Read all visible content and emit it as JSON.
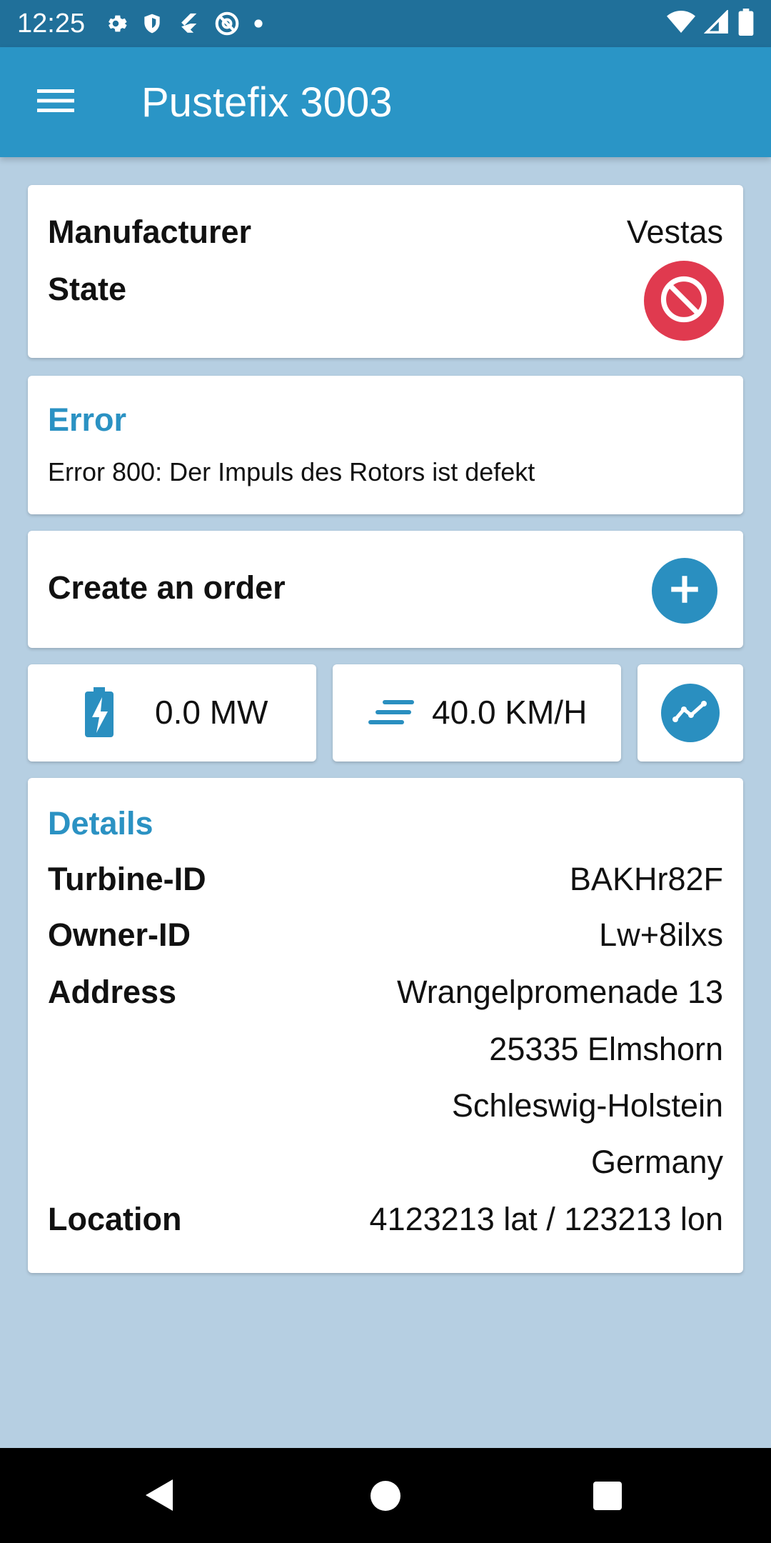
{
  "status_bar": {
    "time": "12:25",
    "icons": [
      "gear-icon",
      "shield-icon",
      "flutter-icon",
      "at-sign-icon",
      "dot-icon"
    ],
    "right_icons": [
      "wifi-icon",
      "signal-icon",
      "battery-icon"
    ]
  },
  "app_bar": {
    "title": "Pustefix 3003",
    "menu_icon": "hamburger-menu-icon"
  },
  "summary": {
    "manufacturer_label": "Manufacturer",
    "manufacturer_value": "Vestas",
    "state_label": "State",
    "state_icon": "block-icon",
    "state_color": "#e03a4f"
  },
  "error": {
    "title": "Error",
    "message": "Error 800: Der Impuls des Rotors ist defekt"
  },
  "order": {
    "label": "Create an order",
    "icon": "plus-icon"
  },
  "stats": {
    "power": {
      "icon": "battery-charging-icon",
      "value": "0.0 MW"
    },
    "wind": {
      "icon": "wind-lines-icon",
      "value": "40.0 KM/H"
    },
    "chart_icon": "trending-line-icon"
  },
  "details": {
    "title": "Details",
    "turbine_id_label": "Turbine-ID",
    "turbine_id_value": "BAKHr82F",
    "owner_id_label": "Owner-ID",
    "owner_id_value": "Lw+8ilxs",
    "address_label": "Address",
    "address_lines": [
      "Wrangelpromenade 13",
      "25335 Elmshorn",
      "Schleswig-Holstein",
      "Germany"
    ],
    "location_label": "Location",
    "location_value": "4123213 lat / 123213 lon"
  },
  "colors": {
    "accent": "#2a95c6",
    "status_bar": "#20709a",
    "background": "#b6cfe2"
  }
}
